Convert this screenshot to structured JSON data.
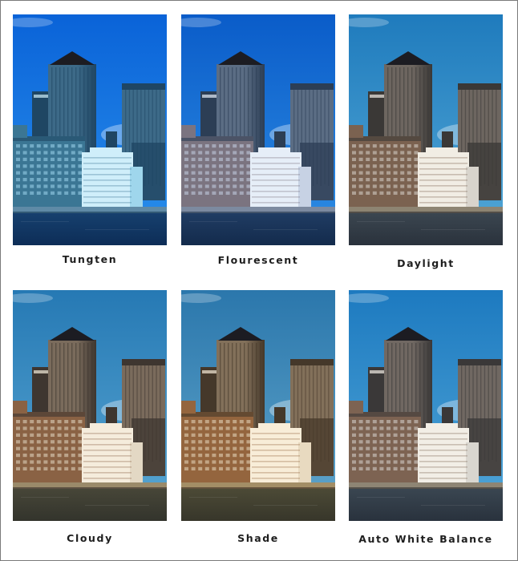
{
  "panels": [
    {
      "label": "Tungten",
      "sky_top": "#0a63d8",
      "sky_bottom": "#2a90ec",
      "tower": "#3d6a88",
      "tower_dark": "#1f4663",
      "block": "#3b7694",
      "block_light": "#9fd6ec",
      "white": "#cfeefa",
      "water_top": "#16406e",
      "water_bottom": "#0d2d57",
      "sea_wall": "#5f8aa6"
    },
    {
      "label": "Flourescent",
      "sky_top": "#0a5cc9",
      "sky_bottom": "#2f8ee4",
      "tower": "#5b6d84",
      "tower_dark": "#2c3e55",
      "block": "#7b7480",
      "block_light": "#c7d2e4",
      "white": "#e6eef8",
      "water_top": "#203c63",
      "water_bottom": "#132b4c",
      "sea_wall": "#7c8aa0"
    },
    {
      "label": "Daylight",
      "sky_top": "#1f7bbd",
      "sky_bottom": "#54a9d7",
      "tower": "#6d6660",
      "tower_dark": "#3a3836",
      "block": "#7b6250",
      "block_light": "#d8d4cc",
      "white": "#f1ede4",
      "water_top": "#3b4650",
      "water_bottom": "#2a323c",
      "sea_wall": "#8d8472"
    },
    {
      "label": "Cloudy",
      "sky_top": "#2679b4",
      "sky_bottom": "#5aa8d4",
      "tower": "#7a6b5c",
      "tower_dark": "#3e3630",
      "block": "#8a6244",
      "block_light": "#e3d8c4",
      "white": "#f5ecdc",
      "water_top": "#474638",
      "water_bottom": "#33342c",
      "sea_wall": "#9a8a6a"
    },
    {
      "label": "Shade",
      "sky_top": "#2b77ac",
      "sky_bottom": "#62a7cc",
      "tower": "#82705a",
      "tower_dark": "#45382a",
      "block": "#94653e",
      "block_light": "#e8dac0",
      "white": "#f8edd8",
      "water_top": "#4c4a36",
      "water_bottom": "#37362a",
      "sea_wall": "#a38e66"
    },
    {
      "label": "Auto White Balance",
      "sky_top": "#1d7ac0",
      "sky_bottom": "#52a7d8",
      "tower": "#706862",
      "tower_dark": "#3a3838",
      "block": "#7d6352",
      "block_light": "#d9d6cf",
      "white": "#f2eee6",
      "water_top": "#3a4651",
      "water_bottom": "#29323d",
      "sea_wall": "#8e8574"
    }
  ]
}
